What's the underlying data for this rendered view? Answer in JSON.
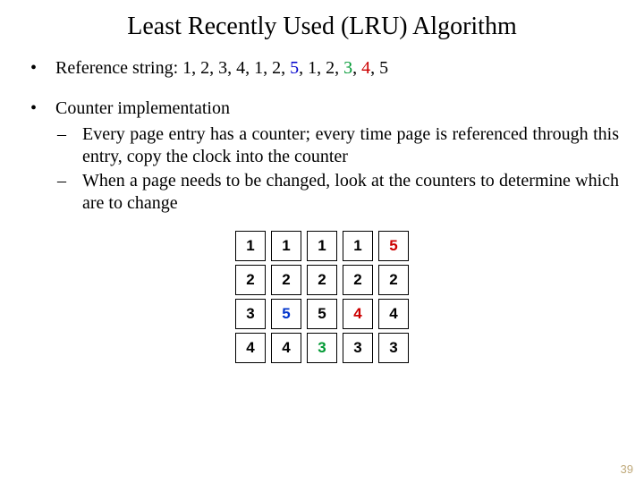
{
  "title": "Least Recently Used (LRU) Algorithm",
  "ref": {
    "label": "Reference string:  ",
    "parts": [
      {
        "t": "1, 2, 3, 4, 1, 2, ",
        "cls": "seg"
      },
      {
        "t": "5",
        "cls": "c-blue"
      },
      {
        "t": ", 1, 2, ",
        "cls": "seg"
      },
      {
        "t": "3",
        "cls": "c-green"
      },
      {
        "t": ", ",
        "cls": "seg"
      },
      {
        "t": "4",
        "cls": "c-red"
      },
      {
        "t": ", 5",
        "cls": "seg"
      }
    ]
  },
  "impl": {
    "heading": "Counter implementation",
    "items": [
      "Every page entry has a counter; every time page is referenced through this entry, copy the clock into the counter",
      "When a page needs to be changed, look at the counters to determine which are to change"
    ]
  },
  "chart_data": {
    "type": "table",
    "title": "LRU frame contents over time",
    "rows": 4,
    "cols": 5,
    "cells": [
      [
        {
          "v": "1",
          "c": "black"
        },
        {
          "v": "1",
          "c": "black"
        },
        {
          "v": "1",
          "c": "black"
        },
        {
          "v": "1",
          "c": "black"
        },
        {
          "v": "5",
          "c": "red"
        }
      ],
      [
        {
          "v": "2",
          "c": "black"
        },
        {
          "v": "2",
          "c": "black"
        },
        {
          "v": "2",
          "c": "black"
        },
        {
          "v": "2",
          "c": "black"
        },
        {
          "v": "2",
          "c": "black"
        }
      ],
      [
        {
          "v": "3",
          "c": "black"
        },
        {
          "v": "5",
          "c": "blue"
        },
        {
          "v": "5",
          "c": "black"
        },
        {
          "v": "4",
          "c": "red"
        },
        {
          "v": "4",
          "c": "black"
        }
      ],
      [
        {
          "v": "4",
          "c": "black"
        },
        {
          "v": "4",
          "c": "black"
        },
        {
          "v": "3",
          "c": "green"
        },
        {
          "v": "3",
          "c": "black"
        },
        {
          "v": "3",
          "c": "black"
        }
      ]
    ]
  },
  "page_number": "39",
  "dot": "•",
  "dash": "–"
}
